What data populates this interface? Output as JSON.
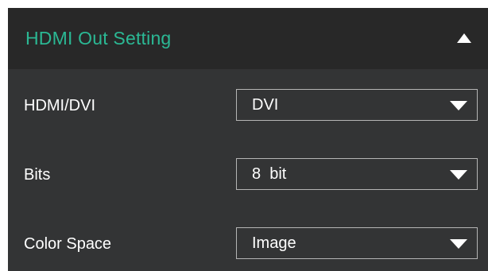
{
  "panel": {
    "title": "HDMI Out Setting",
    "title_color": "#2bb894",
    "collapse_icon": "triangle-up-icon"
  },
  "settings": [
    {
      "label": "HDMI/DVI",
      "value": "DVI",
      "icon": "triangle-down-icon"
    },
    {
      "label": "Bits",
      "value": "8  bit",
      "icon": "triangle-down-icon"
    },
    {
      "label": "Color Space",
      "value": "Image",
      "icon": "triangle-down-icon"
    }
  ],
  "colors": {
    "header_bg": "#282828",
    "body_bg": "#333435",
    "text": "#ffffff",
    "select_border": "#b5b5b5"
  }
}
